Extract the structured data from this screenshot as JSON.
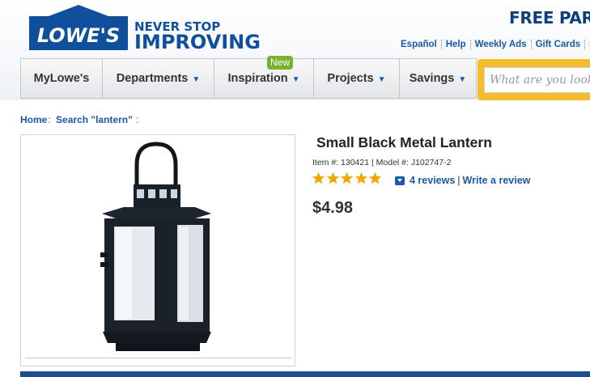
{
  "header": {
    "logo_text": "LOWE'S",
    "tagline_top": "NEVER STOP",
    "tagline_bottom": "IMPROVING",
    "promo": "FREE PARC",
    "util_links": [
      "Español",
      "Help",
      "Weekly Ads",
      "Gift Cards",
      "F"
    ]
  },
  "nav": {
    "items": [
      {
        "label": "MyLowe's",
        "has_chevron": false
      },
      {
        "label": "Departments",
        "has_chevron": true
      },
      {
        "label": "Inspiration",
        "has_chevron": true
      },
      {
        "label": "Projects",
        "has_chevron": true
      },
      {
        "label": "Savings",
        "has_chevron": true
      }
    ],
    "new_badge": "New",
    "search_placeholder": "What are you looking for?"
  },
  "breadcrumb": {
    "home": "Home",
    "search": "Search \"lantern\""
  },
  "product": {
    "title": "Small Black Metal Lantern",
    "item_label": "Item #:",
    "item_number": "130421",
    "model_label": "Model #:",
    "model_number": "J102747-2",
    "rating": 5,
    "max_rating": 5,
    "reviews_link": "4 reviews",
    "write_review": "Write a review",
    "price": "$4.98"
  },
  "colors": {
    "brand_blue": "#0f3e7c",
    "link_blue": "#1b58a7",
    "star_gold": "#f0a800",
    "badge_green": "#78b22f",
    "search_gold": "#f4bd2e"
  },
  "icons": {
    "dropdown": "chevron-down-icon",
    "rating": "star-icon",
    "reviews_toggle": "expand-box-icon"
  }
}
